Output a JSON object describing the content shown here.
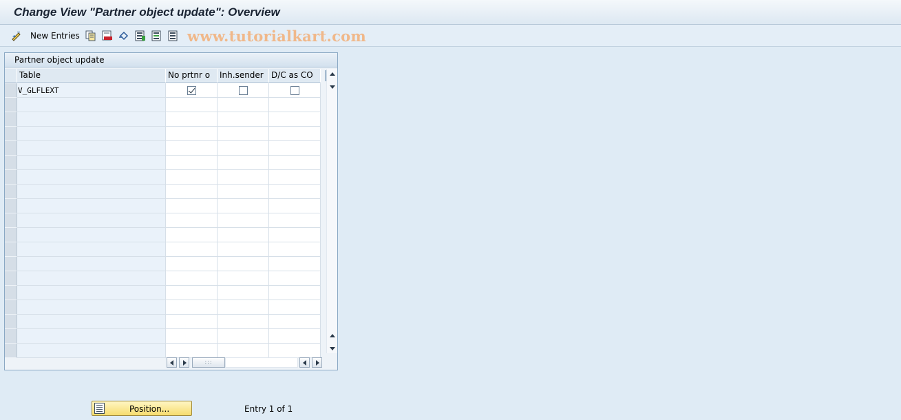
{
  "window": {
    "title": "Change View \"Partner object update\": Overview"
  },
  "toolbar": {
    "new_entries_label": "New Entries",
    "icons": [
      "change-display-icon",
      "new-entries-icon",
      "copy-icon",
      "delete-icon",
      "undo-icon",
      "select-all-icon",
      "select-block-icon",
      "deselect-all-icon"
    ]
  },
  "watermark": "www.tutorialkart.com",
  "panel": {
    "title": "Partner object update",
    "columns": [
      "Table",
      "No prtnr o",
      "Inh.sender",
      "D/C as CO"
    ],
    "rows": [
      {
        "table": "V_GLFLEXT",
        "no_prtnr_o": true,
        "inh_sender": false,
        "dc_as_co": false
      }
    ],
    "empty_row_count": 18
  },
  "footer": {
    "position_button": "Position...",
    "entry_text": "Entry 1 of 1"
  },
  "colors": {
    "background": "#dfebf5",
    "button_yellow": "#f6dc6e",
    "watermark": "#f0b88a"
  }
}
